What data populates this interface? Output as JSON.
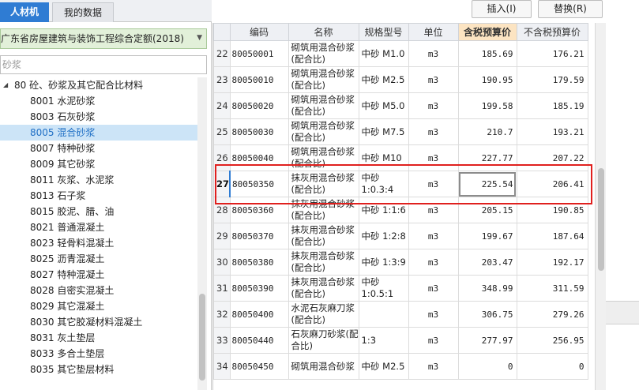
{
  "tabs": [
    {
      "label": "人材机",
      "active": true
    },
    {
      "label": "我的数据",
      "active": false
    }
  ],
  "quota_select": {
    "value": "广东省房屋建筑与装饰工程综合定额(2018)"
  },
  "search": {
    "value": "",
    "placeholder": "砂浆"
  },
  "tree": {
    "parent": "80 砼、砂浆及其它配合比材料",
    "items": [
      {
        "label": "8001 水泥砂浆"
      },
      {
        "label": "8003 石灰砂浆"
      },
      {
        "label": "8005 混合砂浆",
        "selected": true
      },
      {
        "label": "8007 特种砂浆"
      },
      {
        "label": "8009 其它砂浆"
      },
      {
        "label": "8011 灰浆、水泥浆"
      },
      {
        "label": "8013 石子浆"
      },
      {
        "label": "8015 胶泥、腊、油"
      },
      {
        "label": "8021 普通混凝土"
      },
      {
        "label": "8023 轻骨料混凝土"
      },
      {
        "label": "8025 沥青混凝土"
      },
      {
        "label": "8027 特种混凝土"
      },
      {
        "label": "8028 自密实混凝土"
      },
      {
        "label": "8029 其它混凝土"
      },
      {
        "label": "8030 其它胶凝材料混凝土"
      },
      {
        "label": "8031 灰土垫层"
      },
      {
        "label": "8033 多合土垫层"
      },
      {
        "label": "8035 其它垫层材料"
      }
    ]
  },
  "toolbar": {
    "insert_label": "插入(I)",
    "replace_label": "替换(R)"
  },
  "table": {
    "columns": [
      "",
      "编码",
      "名称",
      "规格型号",
      "单位",
      "含税预算价",
      "不含税预算价"
    ],
    "highlight_column": "含税预算价",
    "rows": [
      {
        "idx": "22",
        "code": "80050001",
        "name": "砌筑用混合砂浆(配合比)",
        "spec": "中砂 M1.0",
        "unit": "m3",
        "tax_price": "185.69",
        "notax_price": "176.21"
      },
      {
        "idx": "23",
        "code": "80050010",
        "name": "砌筑用混合砂浆(配合比)",
        "spec": "中砂 M2.5",
        "unit": "m3",
        "tax_price": "190.95",
        "notax_price": "179.59"
      },
      {
        "idx": "24",
        "code": "80050020",
        "name": "砌筑用混合砂浆(配合比)",
        "spec": "中砂 M5.0",
        "unit": "m3",
        "tax_price": "199.58",
        "notax_price": "185.19"
      },
      {
        "idx": "25",
        "code": "80050030",
        "name": "砌筑用混合砂浆(配合比)",
        "spec": "中砂 M7.5",
        "unit": "m3",
        "tax_price": "210.7",
        "notax_price": "193.21"
      },
      {
        "idx": "26",
        "code": "80050040",
        "name": "砌筑用混合砂浆(配合比)",
        "spec": "中砂 M10",
        "unit": "m3",
        "tax_price": "227.77",
        "notax_price": "207.22"
      },
      {
        "idx": "27",
        "code": "80050350",
        "name": "抹灰用混合砂浆(配合比)",
        "spec": "中砂 1:0.3:4",
        "unit": "m3",
        "tax_price": "225.54",
        "notax_price": "206.41",
        "current": true
      },
      {
        "idx": "28",
        "code": "80050360",
        "name": "抹灰用混合砂浆(配合比)",
        "spec": "中砂 1:1:6",
        "unit": "m3",
        "tax_price": "205.15",
        "notax_price": "190.85"
      },
      {
        "idx": "29",
        "code": "80050370",
        "name": "抹灰用混合砂浆(配合比)",
        "spec": "中砂 1:2:8",
        "unit": "m3",
        "tax_price": "199.67",
        "notax_price": "187.64"
      },
      {
        "idx": "30",
        "code": "80050380",
        "name": "抹灰用混合砂浆(配合比)",
        "spec": "中砂 1:3:9",
        "unit": "m3",
        "tax_price": "203.47",
        "notax_price": "192.17"
      },
      {
        "idx": "31",
        "code": "80050390",
        "name": "抹灰用混合砂浆(配合比)",
        "spec": "中砂 1:0.5:1",
        "unit": "m3",
        "tax_price": "348.99",
        "notax_price": "311.59"
      },
      {
        "idx": "32",
        "code": "80050400",
        "name": "水泥石灰麻刀浆(配合比)",
        "spec": "",
        "unit": "m3",
        "tax_price": "306.75",
        "notax_price": "279.26"
      },
      {
        "idx": "33",
        "code": "80050440",
        "name": "石灰麻刀砂浆(配合比)",
        "spec": "1:3",
        "unit": "m3",
        "tax_price": "277.97",
        "notax_price": "256.95"
      },
      {
        "idx": "34",
        "code": "80050450",
        "name": "砌筑用混合砂浆",
        "spec": "中砂 M2.5",
        "unit": "m3",
        "tax_price": "0",
        "notax_price": "0"
      }
    ]
  },
  "colors": {
    "accent": "#2f7cd3",
    "highlight_header": "#fce4c2",
    "annotation_box": "#e0201e",
    "selected_item": "#cce4f7"
  }
}
